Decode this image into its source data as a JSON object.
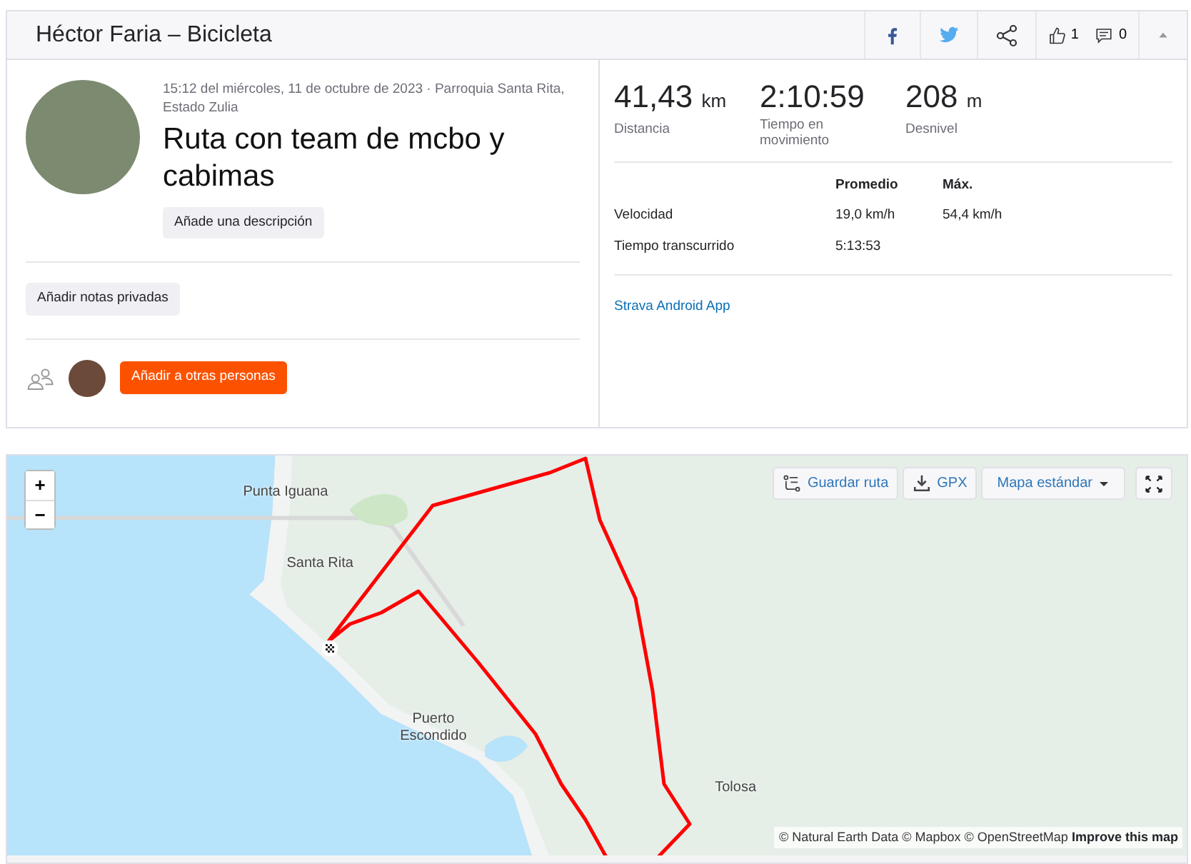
{
  "header": {
    "title": "Héctor Faria – Bicicleta",
    "kudos": "1",
    "comments": "0"
  },
  "activity": {
    "meta": "15:12 del miércoles, 11 de octubre de 2023 · Parroquia Santa Rita, Estado Zulia",
    "title": "Ruta con team de mcbo y cabimas",
    "description_button": "Añade una descripción",
    "notes_button": "Añadir notas privadas",
    "people_button": "Añadir a otras personas"
  },
  "stats": [
    {
      "value": "41,43",
      "unit": "km",
      "label": "Distancia"
    },
    {
      "value": "2:10:59",
      "label": "Tiempo en movimiento"
    },
    {
      "value": "208",
      "unit": "m",
      "label": "Desnivel"
    }
  ],
  "details": {
    "columns": [
      "Promedio",
      "Máx."
    ],
    "rows": [
      {
        "label": "Velocidad",
        "values": [
          "19,0 km/h",
          "54,4 km/h"
        ]
      },
      {
        "label": "Tiempo transcurrido",
        "values": [
          "5:13:53"
        ]
      }
    ]
  },
  "device": "Strava Android App",
  "map": {
    "zoom_in": "+",
    "zoom_out": "−",
    "buttons": [
      {
        "kind": "route",
        "label": "Guardar ruta"
      },
      {
        "kind": "download",
        "label": "GPX"
      },
      {
        "kind": "dropdown",
        "label": "Mapa estándar"
      }
    ],
    "places": [
      "Punta Iguana",
      "Santa Rita",
      "Puerto Escondido",
      "Tolosa"
    ],
    "attribution": "© Natural Earth Data © Mapbox © OpenStreetMap",
    "improve_link": "Improve this map"
  }
}
